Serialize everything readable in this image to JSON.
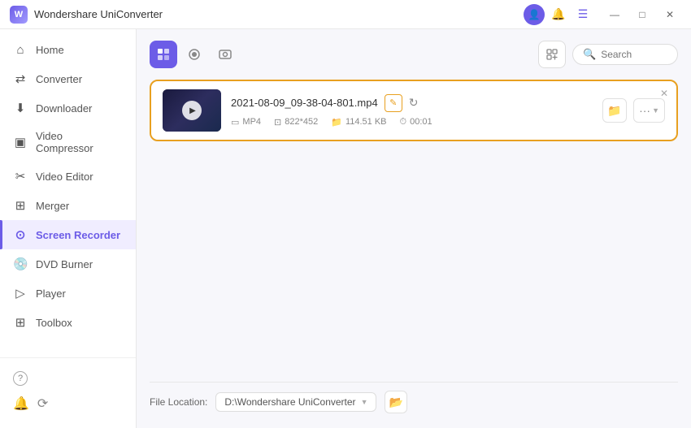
{
  "app": {
    "title": "Wondershare UniConverter",
    "logo_text": "W"
  },
  "titlebar": {
    "icons": {
      "profile": "👤",
      "bell": "🔔",
      "menu": "☰"
    },
    "controls": {
      "minimize": "—",
      "maximize": "□",
      "close": "✕"
    }
  },
  "sidebar": {
    "items": [
      {
        "id": "home",
        "label": "Home",
        "icon": "⌂",
        "active": false
      },
      {
        "id": "converter",
        "label": "Converter",
        "icon": "↔",
        "active": false
      },
      {
        "id": "downloader",
        "label": "Downloader",
        "icon": "↓",
        "active": false
      },
      {
        "id": "video-compressor",
        "label": "Video Compressor",
        "icon": "⊡",
        "active": false
      },
      {
        "id": "video-editor",
        "label": "Video Editor",
        "icon": "✂",
        "active": false
      },
      {
        "id": "merger",
        "label": "Merger",
        "icon": "⊞",
        "active": false
      },
      {
        "id": "screen-recorder",
        "label": "Screen Recorder",
        "icon": "⊙",
        "active": true
      },
      {
        "id": "dvd-burner",
        "label": "DVD Burner",
        "icon": "⊚",
        "active": false
      },
      {
        "id": "player",
        "label": "Player",
        "icon": "▷",
        "active": false
      },
      {
        "id": "toolbox",
        "label": "Toolbox",
        "icon": "⊞",
        "active": false
      }
    ],
    "bottom_items": [
      {
        "id": "help",
        "label": "Help",
        "icon": "?"
      },
      {
        "id": "notifications",
        "label": "Notifications",
        "icon": "🔔"
      },
      {
        "id": "feedback",
        "label": "Feedback",
        "icon": "⟳"
      }
    ]
  },
  "tabs": [
    {
      "id": "tab1",
      "icon": "⊡",
      "active": true
    },
    {
      "id": "tab2",
      "icon": "⊙",
      "active": false
    },
    {
      "id": "tab3",
      "icon": "⊚",
      "active": false
    }
  ],
  "search": {
    "placeholder": "Search",
    "icon": "🔍"
  },
  "file_card": {
    "filename": "2021-08-09_09-38-04-801.mp4",
    "format": "MP4",
    "resolution": "822*452",
    "size": "114.51 KB",
    "duration": "00:01",
    "has_edit": true,
    "has_refresh": true
  },
  "footer": {
    "file_location_label": "File Location:",
    "file_location_path": "D:\\Wondershare UniConverter",
    "dropdown_arrow": "▼"
  }
}
